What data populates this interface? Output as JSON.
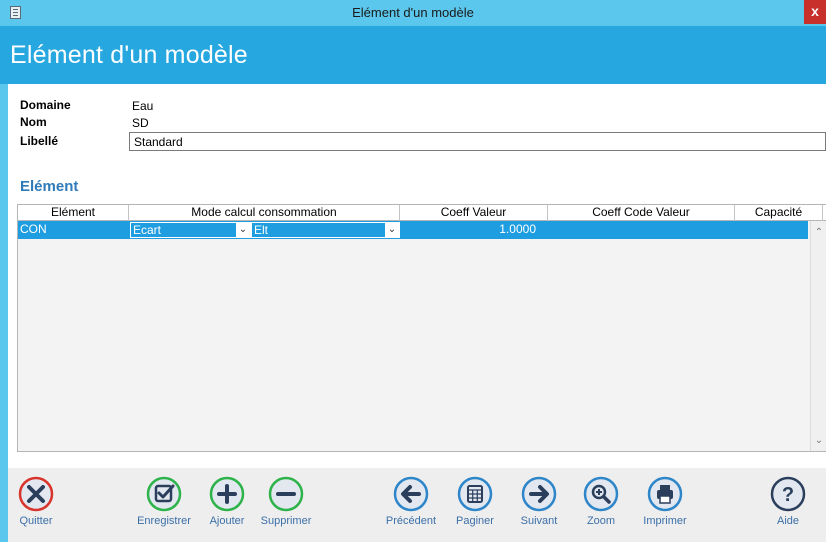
{
  "window": {
    "title": "Elément d'un modèle",
    "close_label": "x"
  },
  "header": {
    "title": "Elément d'un modèle"
  },
  "form": {
    "domaine_label": "Domaine",
    "domaine_value": "Eau",
    "nom_label": "Nom",
    "nom_value": "SD",
    "libelle_label": "Libellé",
    "libelle_value": "Standard"
  },
  "section": {
    "title": "Elément"
  },
  "grid": {
    "columns": [
      "Elément",
      "Mode calcul consommation",
      "Coeff Valeur",
      "Coeff Code Valeur",
      "Capacité"
    ],
    "rows": [
      {
        "element": "CON",
        "mode_1": "Ecart",
        "mode_2": "Elt",
        "coeff_valeur": "1.0000",
        "coeff_code_valeur": "",
        "capacite": ""
      }
    ]
  },
  "toolbar": {
    "quitter": "Quitter",
    "enregistrer": "Enregistrer",
    "ajouter": "Ajouter",
    "supprimer": "Supprimer",
    "precedent": "Précédent",
    "paginer": "Paginer",
    "suivant": "Suivant",
    "zoom": "Zoom",
    "imprimer": "Imprimer",
    "aide": "Aide"
  },
  "colors": {
    "title_bar": "#5bc7ec",
    "header_band": "#26a7df",
    "selected_row": "#1e9ee0",
    "section_title": "#2f7ab8",
    "quit_red": "#d9342b",
    "add_green": "#2db34a",
    "nav_blue": "#2e86c9",
    "help_navy": "#2b3f5c"
  }
}
